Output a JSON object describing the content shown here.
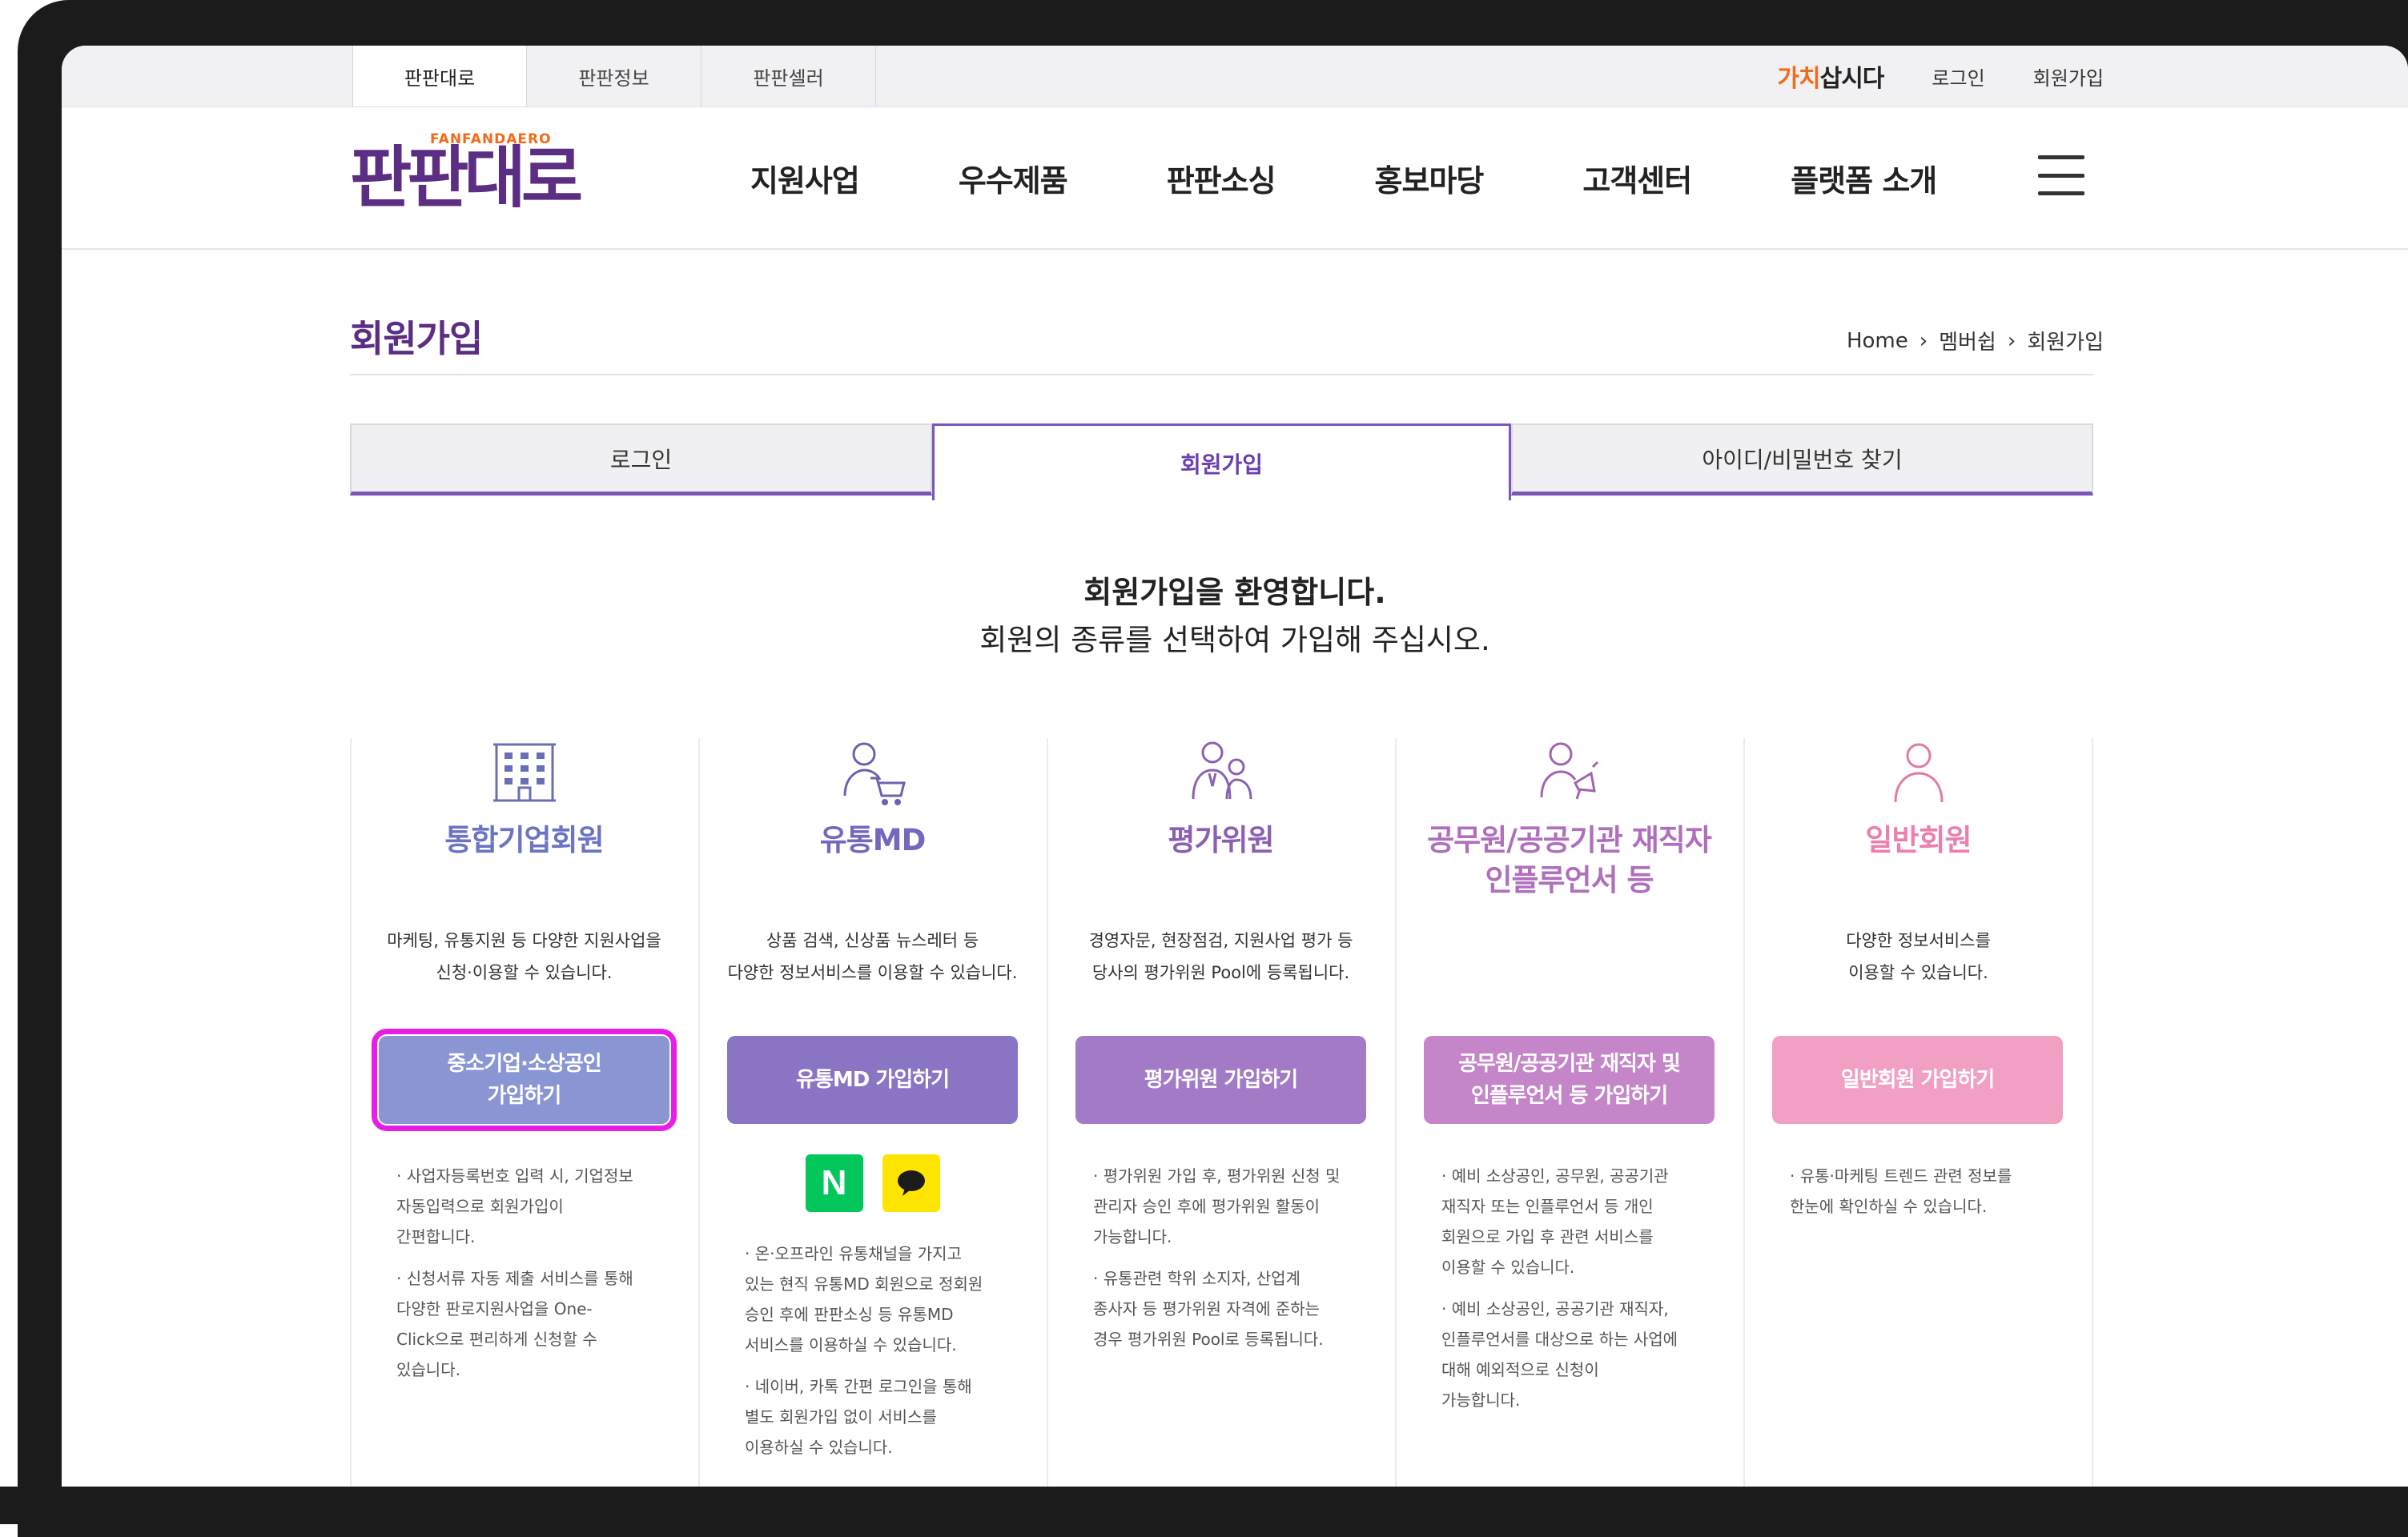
{
  "site_tabs": [
    "판판대로",
    "판판정보",
    "판판셀러"
  ],
  "util_links": {
    "brand_orange": "가치",
    "brand_dark": "삽시다",
    "login": "로그인",
    "signup": "회원가입"
  },
  "logo": {
    "sub": "FANFANDAERO",
    "main": "판판대로"
  },
  "gnb": [
    "지원사업",
    "우수제품",
    "판판소싱",
    "홍보마당",
    "고객센터",
    "플랫폼 소개"
  ],
  "page": {
    "title": "회원가입",
    "breadcrumb": [
      "Home",
      "멤버쉽",
      "회원가입"
    ]
  },
  "tabs": [
    {
      "label": "로그인",
      "active": false
    },
    {
      "label": "회원가입",
      "active": true
    },
    {
      "label": "아이디/비밀번호 찾기",
      "active": false
    }
  ],
  "welcome": {
    "line1": "회원가입을 환영합니다.",
    "line2": "회원의 종류를 선택하여 가입해 주십시오."
  },
  "member_types": [
    {
      "icon": "building-icon",
      "name": "통합기업회원",
      "desc": "마케팅, 유통지원 등 다양한 지원사업을\n신청·이용할 수 있습니다.",
      "button": "중소기업·소상공인\n가입하기",
      "notes": [
        "· 사업자등록번호 입력 시, 기업정보\n자동입력으로 회원가입이\n간편합니다.",
        "· 신청서류 자동 제출 서비스를 통해\n다양한 판로지원사업을 One-\nClick으로 편리하게 신청할 수\n있습니다."
      ]
    },
    {
      "icon": "person-cart-icon",
      "name": "유통MD",
      "desc": "상품 검색, 신상품 뉴스레터 등\n다양한 정보서비스를 이용할 수 있습니다.",
      "button": "유통MD 가입하기",
      "social": [
        "N",
        "kakao"
      ],
      "notes": [
        "· 온·오프라인 유통채널을 가지고\n있는 현직 유통MD 회원으로 정회원\n승인 후에 판판소싱 등 유통MD\n서비스를 이용하실 수 있습니다.",
        "· 네이버, 카톡 간편 로그인을 통해\n별도 회원가입 없이 서비스를\n이용하실 수 있습니다."
      ]
    },
    {
      "icon": "evaluators-icon",
      "name": "평가위원",
      "desc": "경영자문, 현장점검, 지원사업 평가 등\n당사의 평가위원 Pool에 등록됩니다.",
      "button": "평가위원 가입하기",
      "notes": [
        "· 평가위원 가입 후, 평가위원 신청 및\n관리자 승인 후에 평가위원 활동이\n가능합니다.",
        "· 유통관련 학위 소지자, 산업계\n종사자 등 평가위원 자격에 준하는\n경우 평가위원 Pool로 등록됩니다."
      ]
    },
    {
      "icon": "person-megaphone-icon",
      "name": "공무원/공공기관 재직자\n인플루언서 등",
      "desc": "",
      "button": "공무원/공공기관 재직자 및\n인플루언서 등 가입하기",
      "notes": [
        "· 예비 소상공인, 공무원, 공공기관\n재직자 또는 인플루언서 등 개인\n회원으로 가입 후 관련 서비스를\n이용할 수 있습니다.",
        "· 예비 소상공인, 공공기관 재직자,\n인플루언서를 대상으로 하는 사업에\n대해 예외적으로 신청이\n가능합니다."
      ]
    },
    {
      "icon": "person-icon",
      "name": "일반회원",
      "desc": "다양한 정보서비스를\n이용할 수 있습니다.",
      "button": "일반회원 가입하기",
      "notes": [
        "· 유통·마케팅 트렌드 관련 정보를\n한눈에 확인하실 수 있습니다."
      ]
    }
  ],
  "colors": {
    "brand_purple": "#5b2d83",
    "tab_active": "#6c3fb0",
    "btn_company": "#8a95d4",
    "btn_md": "#8a75c4",
    "btn_evaluator": "#a27ac5",
    "btn_public": "#c486c8",
    "btn_general": "#f1a0c4",
    "highlight": "#e61ee6"
  }
}
